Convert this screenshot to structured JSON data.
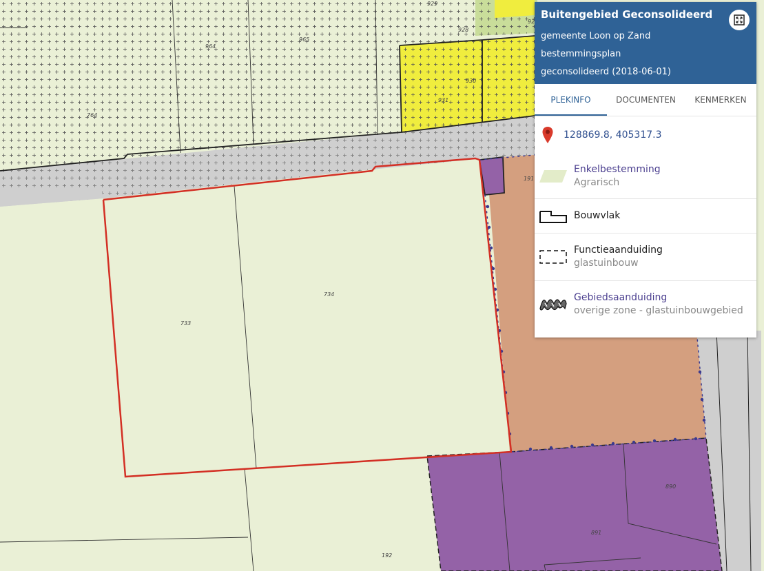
{
  "header": {
    "title": "Buitengebied Geconsolideerd",
    "municipality": "gemeente Loon op Zand",
    "plan_type": "bestemmingsplan",
    "status": "geconsolideerd (2018-06-01)"
  },
  "tabs": [
    {
      "label": "PLEKINFO",
      "active": true
    },
    {
      "label": "DOCUMENTEN",
      "active": false
    },
    {
      "label": "KENMERKEN",
      "active": false
    }
  ],
  "location": {
    "coordinates": "128869.8, 405317.3"
  },
  "legend": [
    {
      "label": "Enkelbestemming",
      "sub": "Agrarisch",
      "icon": "agrarisch-swatch-icon",
      "color": "#e3ecc9"
    },
    {
      "label": "Bouwvlak",
      "sub": "",
      "icon": "bouwvlak-outline-icon"
    },
    {
      "label": "Functieaanduiding",
      "sub": "glastuinbouw",
      "icon": "dashed-rectangle-icon"
    },
    {
      "label": "Gebiedsaanduiding",
      "sub": "overige zone - glastuinbouwgebied",
      "icon": "hatched-zone-icon"
    }
  ],
  "map": {
    "parcel_numbers": [
      "929",
      "928",
      "92",
      "965",
      "964",
      "930",
      "931",
      "764",
      "191",
      "734",
      "733",
      "890",
      "891",
      "192"
    ],
    "colors": {
      "agrarisch": "#eaf0d6",
      "glastuinbouw": "#f0ed3e",
      "road": "#cfcfcf",
      "bedrijf": "#d49f7f",
      "purple": "#9462a7",
      "selection": "#d32f24",
      "header": "#2f6296"
    }
  }
}
